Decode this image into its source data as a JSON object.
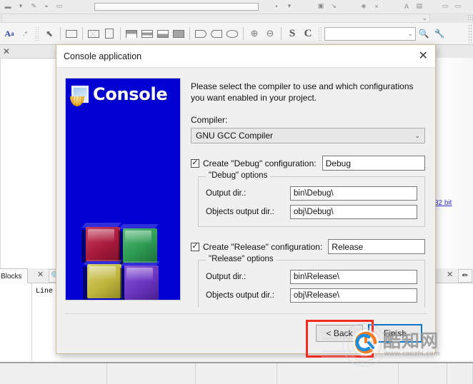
{
  "ide": {
    "toolbar_search_placeholder": "",
    "editor_tab_label": "",
    "link_32bit": "32 bit",
    "bottom_tab_label": "Blocks",
    "bottom_line_label": "Line",
    "toolbar_icons": [
      "text-style-icon",
      "wildcard-icon",
      "pointer-icon",
      "rectangle-icon",
      "envelope-icon",
      "document-icon",
      "frame-top-icon",
      "frame-band-icon",
      "frame-bottom-icon",
      "frame-filled-icon",
      "tag-right-icon",
      "tag-left-icon",
      "hexagon-icon",
      "zoom-in-icon",
      "zoom-out-icon",
      "letter-s-icon",
      "letter-c-icon",
      "find-icon",
      "tools-icon"
    ]
  },
  "dialog": {
    "title": "Console application",
    "close_icon": "close-icon",
    "banner": {
      "label": "Console",
      "background_color": "#0000d2",
      "icon": "console-shell-icon",
      "cubes": [
        {
          "name": "cube-top-left",
          "color": "#b02040"
        },
        {
          "name": "cube-top-right",
          "color": "#2e9e52"
        },
        {
          "name": "cube-bottom-left",
          "color": "#c3bb42"
        },
        {
          "name": "cube-bottom-right",
          "color": "#6b35c0"
        }
      ]
    },
    "intro_text": "Please select the compiler to use and which configurations you want enabled in your project.",
    "compiler": {
      "label": "Compiler:",
      "selected": "GNU GCC Compiler",
      "chevron": "chevron-down-icon"
    },
    "debug": {
      "checkbox_label": "Create \"Debug\" configuration:",
      "checked": true,
      "name_value": "Debug",
      "group_title": "\"Debug\" options",
      "output_dir_label": "Output dir.:",
      "output_dir_value": "bin\\Debug\\",
      "objects_dir_label": "Objects output dir.:",
      "objects_dir_value": "obj\\Debug\\"
    },
    "release": {
      "checkbox_label": "Create \"Release\" configuration:",
      "checked": true,
      "name_value": "Release",
      "group_title": "\"Release\" options",
      "output_dir_label": "Output dir.:",
      "output_dir_value": "bin\\Release\\",
      "objects_dir_label": "Objects output dir.:",
      "objects_dir_value": "obj\\Release\\"
    },
    "footer": {
      "back_label": "< Back",
      "finish_label": "Finish",
      "finish_focus_color": "#0f73c8"
    }
  },
  "annotation": {
    "highlight_color": "#ef2b22",
    "target": "finish-button"
  },
  "watermark": {
    "text_cn": "酷知网",
    "url": "www.coozhi.com"
  }
}
